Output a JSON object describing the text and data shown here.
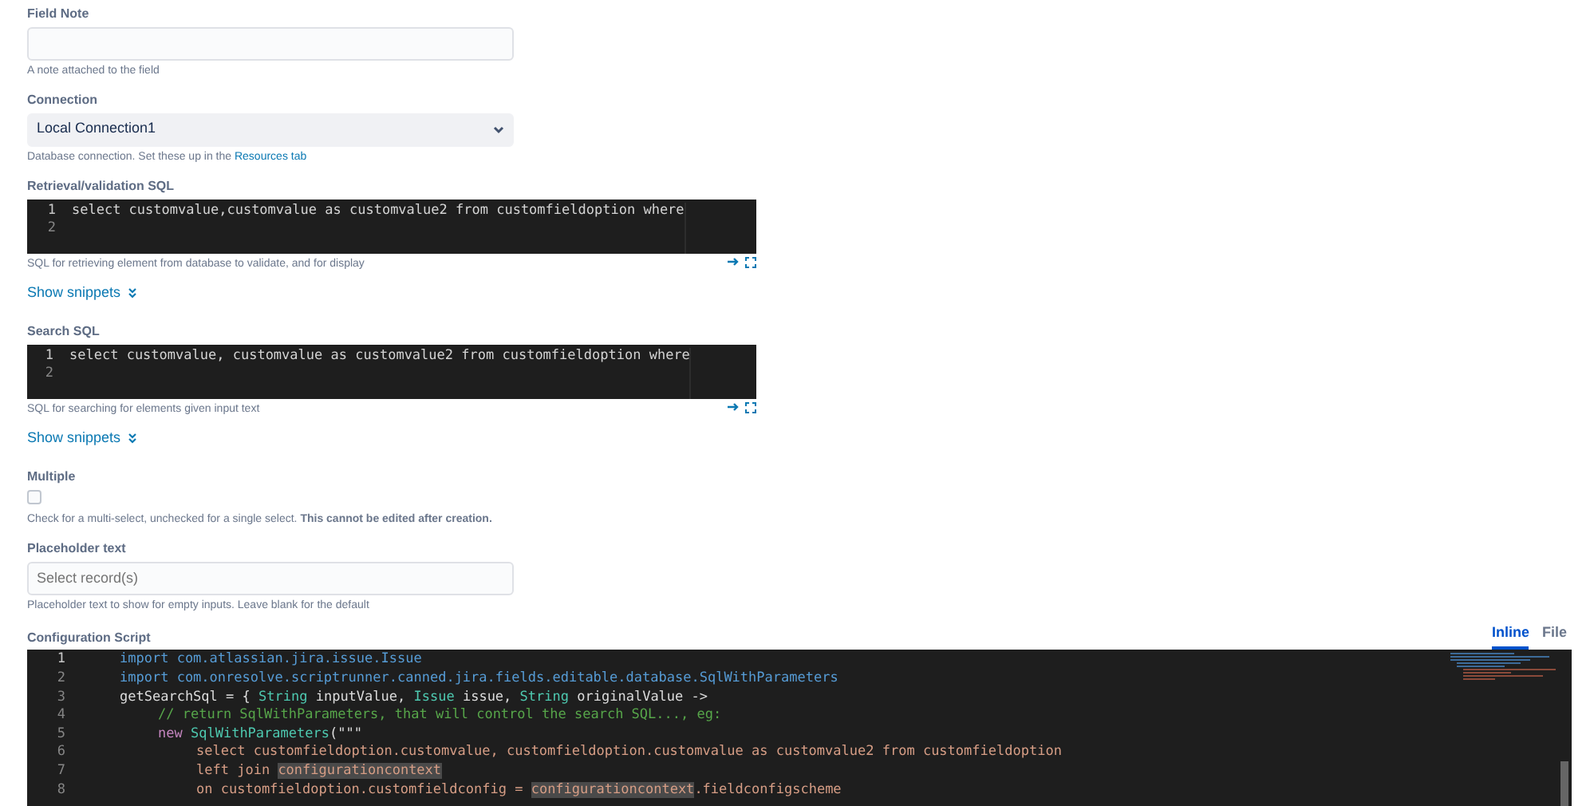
{
  "field_note": {
    "label": "Field Note",
    "help": "A note attached to the field"
  },
  "connection": {
    "label": "Connection",
    "value": "Local Connection1",
    "help": "Database connection. Set these up in the",
    "help_link": "Resources tab"
  },
  "editors": [
    {
      "label": "Retrieval/validation SQL",
      "lines": [
        "select customvalue,customvalue as customvalue2 from customfieldoption where"
      ],
      "line_numbers": [
        "1",
        "2"
      ],
      "help": "SQL for retrieving element from database to validate, and for display",
      "snippets": "Show snippets"
    },
    {
      "label": "Search SQL",
      "lines": [
        "select customvalue, customvalue as customvalue2 from customfieldoption where"
      ],
      "line_numbers": [
        "1",
        "2"
      ],
      "help": "SQL for searching for elements given input text",
      "snippets": "Show snippets"
    }
  ],
  "multiple": {
    "label": "Multiple",
    "checked": false,
    "help": "Check for a multi-select, unchecked for a single select. **This cannot be edited after creation.**"
  },
  "placeholder_text": {
    "label": "Placeholder text",
    "placeholder": "Select record(s)",
    "help": "Placeholder text to show for empty inputs. Leave blank for the default"
  },
  "config_script": {
    "label": "Configuration Script",
    "tabs": [
      {
        "label": "Inline",
        "selected": true
      },
      {
        "label": "File",
        "selected": false
      }
    ],
    "lines": [
      {
        "number": "1",
        "segments": [
          {
            "kind": "keyword",
            "text": "import com.atlassian.jira.issue.Issue"
          }
        ]
      },
      {
        "number": "2",
        "segments": [
          {
            "kind": "keyword",
            "text": "import com.onresolve.scriptrunner.canned.jira.fields.editable.database.SqlWithParameters"
          }
        ]
      },
      {
        "number": "3",
        "segments": [
          {
            "kind": "plain",
            "text": "getSearchSql = { "
          },
          {
            "kind": "type",
            "text": "String"
          },
          {
            "kind": "plain",
            "text": " inputValue, "
          },
          {
            "kind": "type",
            "text": "Issue"
          },
          {
            "kind": "plain",
            "text": " issue, "
          },
          {
            "kind": "type",
            "text": "String"
          },
          {
            "kind": "plain",
            "text": " originalValue ->"
          }
        ],
        "children": [
          {
            "number": "4",
            "segments": [
              {
                "kind": "comment",
                "text": "// return SqlWithParameters, that will control the search SQL..., eg:"
              }
            ]
          },
          {
            "number": "5",
            "segments": [
              {
                "kind": "new",
                "text": "new "
              },
              {
                "kind": "type",
                "text": "SqlWithParameters"
              },
              {
                "kind": "plain",
                "text": "(\"\"\""
              }
            ],
            "children": [
              {
                "number": "6",
                "segments": [
                  {
                    "kind": "string",
                    "text": "select customfieldoption.customvalue, customfieldoption.customvalue as customvalue2 from customfieldoption"
                  }
                ]
              },
              {
                "number": "7",
                "segments": [
                  {
                    "kind": "string",
                    "text": "left join "
                  },
                  {
                    "kind": "highlight",
                    "text": "configurationcontext"
                  }
                ]
              },
              {
                "number": "8",
                "segments": [
                  {
                    "kind": "string",
                    "text": "on customfieldoption.customfieldconfig = "
                  },
                  {
                    "kind": "highlight",
                    "text": "configurationcontext"
                  },
                  {
                    "kind": "string",
                    "text": ".fieldconfigscheme"
                  }
                ]
              }
            ]
          }
        ]
      }
    ]
  }
}
